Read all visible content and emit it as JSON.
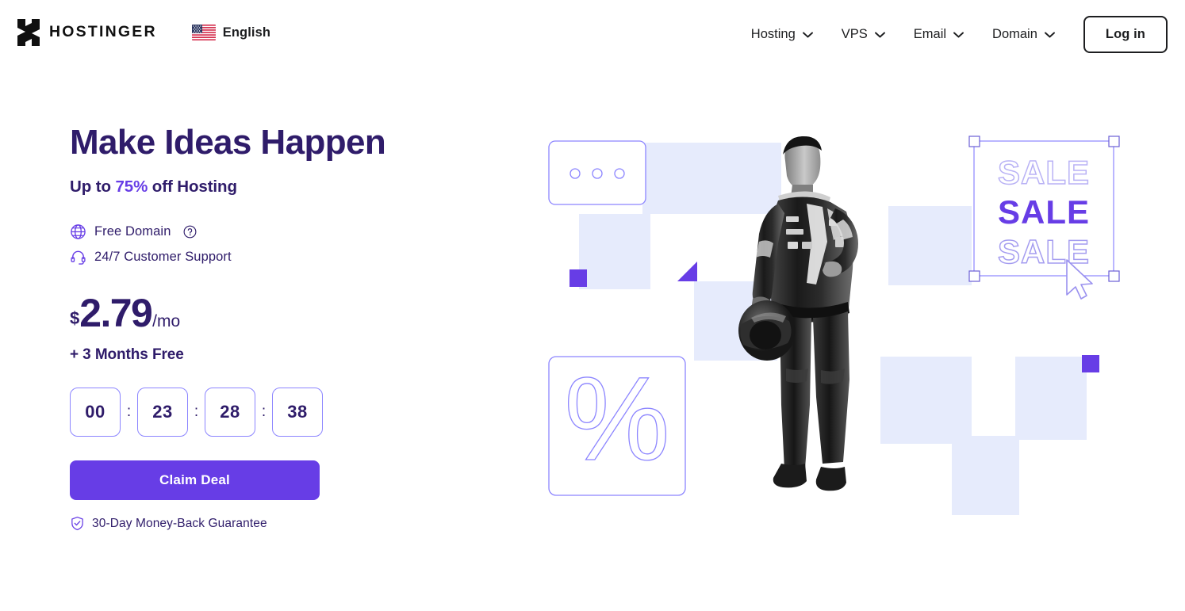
{
  "header": {
    "logo_text": "HOSTINGER",
    "logo_icon": "hostinger-h-logo",
    "language": {
      "flag_icon": "us-flag-icon",
      "label": "English"
    },
    "nav_items": [
      {
        "label": "Hosting",
        "icon": "chevron-down-icon"
      },
      {
        "label": "VPS",
        "icon": "chevron-down-icon"
      },
      {
        "label": "Email",
        "icon": "chevron-down-icon"
      },
      {
        "label": "Domain",
        "icon": "chevron-down-icon"
      }
    ],
    "login_label": "Log in"
  },
  "hero": {
    "headline": "Make Ideas Happen",
    "subhead_prefix": "Up to ",
    "subhead_accent": "75%",
    "subhead_suffix": " off Hosting",
    "features": [
      {
        "icon": "globe-icon",
        "label": "Free Domain",
        "help_icon": "question-mark-icon"
      },
      {
        "icon": "headset-icon",
        "label": "24/7 Customer Support"
      }
    ],
    "price": {
      "currency": "$",
      "amount": "2.79",
      "period": "/mo"
    },
    "bonus": "+ 3 Months Free",
    "countdown": {
      "days": "00",
      "hours": "23",
      "minutes": "28",
      "seconds": "38",
      "separator": ":"
    },
    "cta_label": "Claim Deal",
    "guarantee": {
      "icon": "shield-check-icon",
      "label": "30-Day Money-Back Guarantee"
    }
  },
  "illustration": {
    "sale_text_top": "SALE",
    "sale_text_middle": "SALE",
    "sale_text_bottom": "SALE",
    "percent_symbol": "%",
    "cursor_icon": "arrow-cursor-icon",
    "photo_alt": "racing-driver-holding-helmet"
  },
  "colors": {
    "brand_purple": "#673de6",
    "deep_purple": "#2f1c6a",
    "light_lavender": "#e6ebfc",
    "outline_purple": "#8c85ff",
    "text_dark": "#1d1e20",
    "white": "#ffffff"
  }
}
